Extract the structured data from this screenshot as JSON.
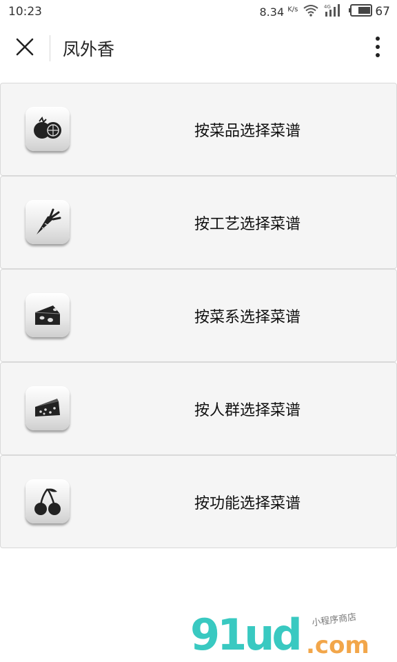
{
  "status_bar": {
    "time": "10:23",
    "speed_value": "8.34",
    "speed_unit": "K/s",
    "network": "4G",
    "battery": "67"
  },
  "nav": {
    "title": "凤外香",
    "close_icon": "close-icon",
    "more_icon": "more-vertical-icon"
  },
  "menu": {
    "items": [
      {
        "label": "按菜品选择菜谱",
        "icon": "tomato-icon"
      },
      {
        "label": "按工艺选择菜谱",
        "icon": "carrot-icon"
      },
      {
        "label": "按菜系选择菜谱",
        "icon": "cheese-icon"
      },
      {
        "label": "按人群选择菜谱",
        "icon": "cake-icon"
      },
      {
        "label": "按功能选择菜谱",
        "icon": "cherry-icon"
      }
    ]
  },
  "watermark": {
    "main": "91ud",
    "domain": ".com",
    "tagline": "小程序商店"
  },
  "colors": {
    "watermark_teal": "#39c9c1",
    "watermark_orange": "#f2a64a",
    "card_bg": "#f5f5f5"
  }
}
